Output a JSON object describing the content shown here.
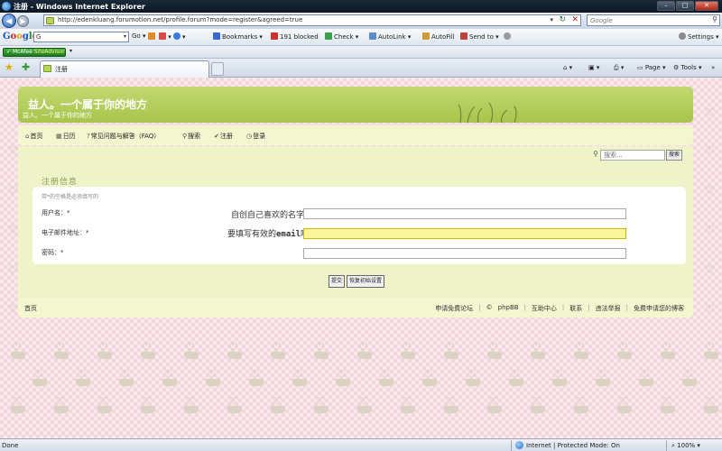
{
  "window": {
    "title": "注册 - Windows Internet Explorer"
  },
  "address": {
    "url": "http://edenkluang.forumotion.net/profile.forum?mode=register&agreed=true",
    "search_placeholder": "Google"
  },
  "google_toolbar": {
    "logo": "Google",
    "search_value": "G",
    "go_label": "Go",
    "bookmarks": "Bookmarks",
    "blocked": "191 blocked",
    "check": "Check",
    "autolink": "AutoLink",
    "autofill": "AutoFill",
    "send_to": "Send to",
    "settings": "Settings"
  },
  "mcafee": {
    "brand": "McAfee",
    "product": "SiteAdvisor"
  },
  "tab": {
    "label": "注册"
  },
  "commands": {
    "page": "Page",
    "tools": "Tools"
  },
  "site": {
    "title": "益人。一个属于你的地方",
    "description": "益人。一个属于你的地方"
  },
  "nav": {
    "items": [
      {
        "icon": "⌂",
        "label": "首页"
      },
      {
        "icon": "▦",
        "label": "日历"
      },
      {
        "icon": "?",
        "label": "常见问题与解答（FAQ）"
      },
      {
        "icon": "⚲",
        "label": "搜索"
      },
      {
        "icon": "✔",
        "label": "注册"
      },
      {
        "icon": "◷",
        "label": "登录"
      }
    ]
  },
  "mini_search": {
    "placeholder": "搜索...",
    "button": "搜索"
  },
  "register": {
    "heading": "注册信息",
    "note": "带*的空格是必须填写的",
    "fields": [
      {
        "label": "用户名：*",
        "hint": "自创自己喜欢的名字"
      },
      {
        "label": "电子邮件地址：*",
        "hint_pre": "要填写有效的",
        "hint_bold": "email",
        "hint_post": "哦！"
      },
      {
        "label": "密码：*",
        "hint": ""
      }
    ],
    "submit": "提交",
    "reset": "恢复初始设置"
  },
  "footer": {
    "home": "首页",
    "links": [
      "申请免费论坛",
      "©",
      "phpBB",
      "互助中心",
      "联系",
      "违法举报",
      "免费申请您的博客"
    ]
  },
  "status": {
    "done": "Done",
    "zone": "Internet | Protected Mode: On",
    "zoom": "100%"
  },
  "colors": {
    "header_green": "#a8c44a",
    "panel_green": "#eef4c8",
    "highlight_yellow": "#fbf59a",
    "background_pink": "#f9e8ec"
  }
}
